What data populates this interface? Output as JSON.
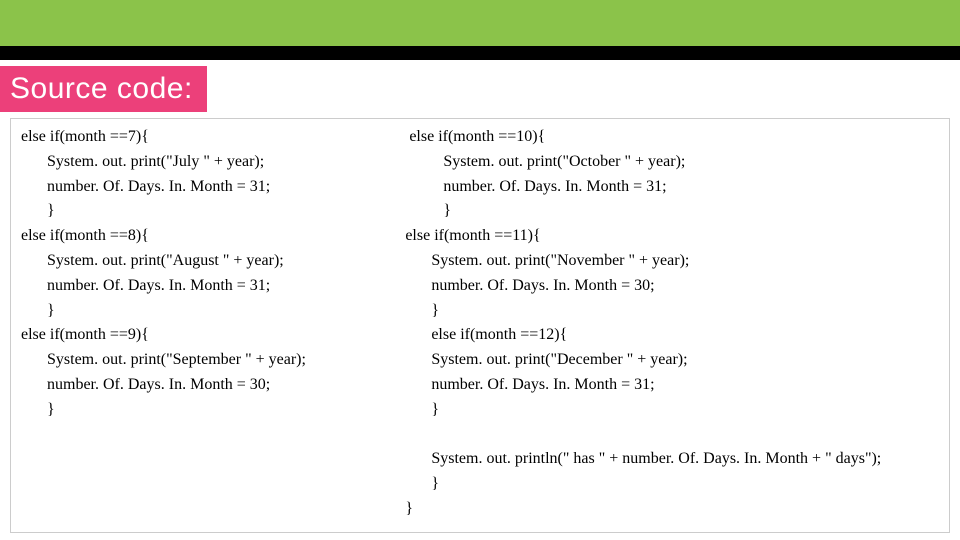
{
  "title": "Source code:",
  "left": {
    "l1": "else if(month ==7){",
    "l2": "System. out. print(\"July \" + year);",
    "l3": "number. Of. Days. In. Month = 31;",
    "l4": "}",
    "l5": "else if(month ==8){",
    "l6": "System. out. print(\"August \" + year);",
    "l7": "number. Of. Days. In. Month = 31;",
    "l8": "}",
    "l9": "else if(month ==9){",
    "l10": "System. out. print(\"September \" + year);",
    "l11": "number. Of. Days. In. Month = 30;",
    "l12": "}"
  },
  "right": {
    "r1": " else if(month ==10){",
    "r2": "System. out. print(\"October \" + year);",
    "r3": "number. Of. Days. In. Month = 31;",
    "r4": "}",
    "r5": "else if(month ==11){",
    "r6": "System. out. print(\"November \" + year);",
    "r7": "number. Of. Days. In. Month = 30;",
    "r8": "}",
    "r9": "else if(month ==12){",
    "r10": "System. out. print(\"December \" + year);",
    "r11": "number. Of. Days. In. Month = 31;",
    "r12": "}",
    "r13": " ",
    "r14": "System. out. println(\" has \" + number. Of. Days. In. Month + \" days\");",
    "r15": "}",
    "r16": "}"
  }
}
